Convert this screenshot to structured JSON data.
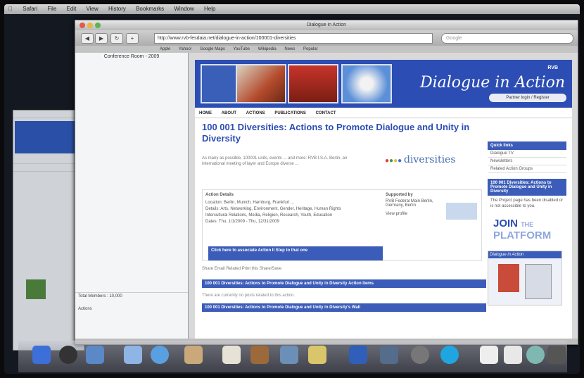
{
  "menubar": {
    "items": [
      "",
      "Safari",
      "File",
      "Edit",
      "View",
      "History",
      "Bookmarks",
      "Window",
      "Help"
    ],
    "clock": ""
  },
  "browser": {
    "window_title": "Dialogue in Action",
    "url": "http://www.rvb-fesdaia.net/dialogue-in-action/100001-diversities",
    "search_placeholder": "Google",
    "bookmarks": [
      "Apple",
      "Yahoo!",
      "Google Maps",
      "YouTube",
      "Wikipedia",
      "News",
      "Popular"
    ]
  },
  "sidebar": {
    "header": "Conference Room - 2009",
    "footer_line1": "Total Members : 10,000",
    "footer_line2": "Actions"
  },
  "site": {
    "flag": "RVB",
    "title": "Dialogue in Action",
    "pill": "Partner login / Register",
    "nav": [
      "HOME",
      "ABOUT",
      "ACTIONS",
      "PUBLICATIONS",
      "CONTACT"
    ],
    "heading": "100 001 Diversities: Actions to Promote Dialogue and Unity in Diversity",
    "intro": "As many as possible, 100001 units, events ... and more: RVB I.S.A. Berlin, an international meeting of layer and Europe diverse ...",
    "logo_text": "diversities",
    "details_heading": "Action Details",
    "details_lines": [
      "Location: Berlin, Munich, Hamburg, Frankfurt ...",
      "Details: Arts, Networking, Environment, Gender, Heritage, Human Rights",
      "Intercultural Relations, Media, Religion, Research, Youth, Education",
      "Dates: Thu, 1/1/2009 - Thu, 12/31/2009"
    ],
    "supported_by": "Supported by",
    "supported_text": "RVB Federal Main Berlin, Germany, Berlin",
    "supported_more": "View profile",
    "action_button": "Click here to associate Action II Step to that one",
    "social": "Share Email  Related  Print this  Share/Save",
    "bar1": "100 001 Diversities: Actions to Promote Dialogue and Unity in Diversity Action Items",
    "line2": "There are currently no posts related to this action.",
    "bar2": "100 001 Diversities: Actions to Promote Dialogue and Unity in Diversity's Wall",
    "right_box_title": "Quick links",
    "right_links": [
      "Dialogue TV",
      "Newsletters",
      "Related Action Groups"
    ],
    "right_box2_title": "100 001 Diversities: Actions to Promote Dialogue and Unity in Diversity",
    "right_box2_text": "The Project page has been disabled or is not accessible to you.",
    "join_1": "JOIN",
    "join_2": "THE",
    "join_3": "PLATFORM",
    "ad_title": "Dialogue in Action"
  },
  "colors": {
    "brand": "#2c4db3",
    "page_bg": "#ffffff"
  },
  "dock_icons": [
    "finder-icon",
    "system-icon",
    "safari-icon",
    "mail-icon",
    "ical-icon",
    "photos-icon",
    "itunes-icon",
    "preferences-icon",
    "skype-icon",
    "trash-icon"
  ]
}
